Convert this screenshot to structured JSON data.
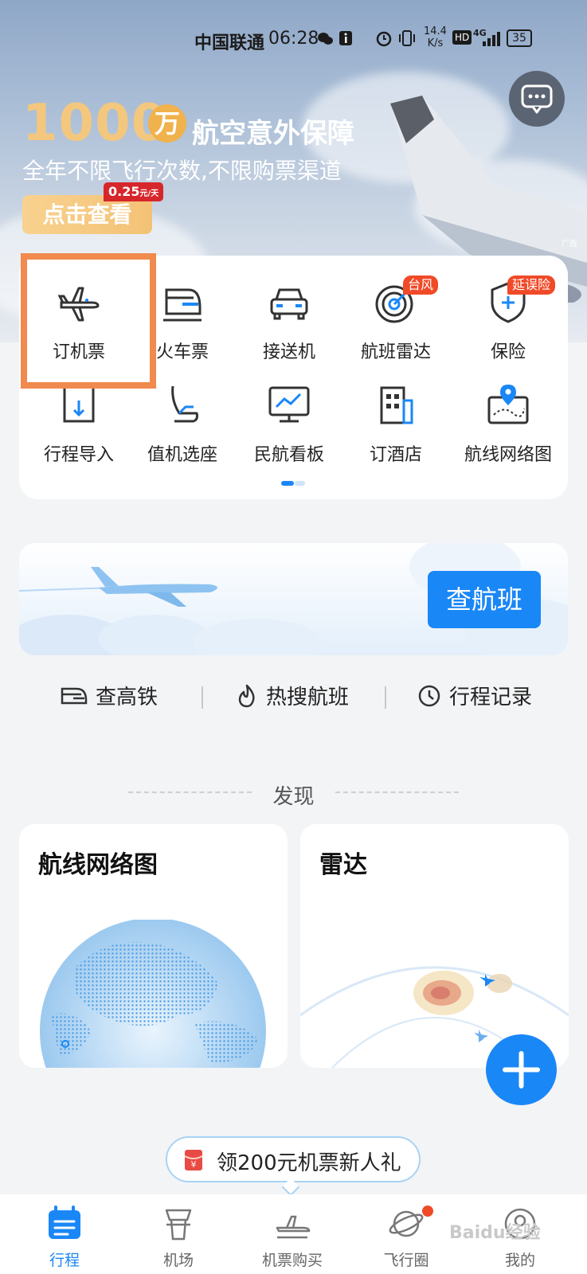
{
  "status_bar": {
    "carrier": "中国联通",
    "time": "06:28",
    "net_speed_value": "14.4",
    "net_speed_unit": "K/s",
    "hd": "HD",
    "network": "4G",
    "battery": "35"
  },
  "banner": {
    "big_number": "1000",
    "unit": "万",
    "title": "航空意外保障",
    "subtitle": "全年不限飞行次数,不限购票渠道",
    "button": "点击查看",
    "price": "0.25",
    "price_unit": "元/天",
    "ad_label": "广告"
  },
  "services": {
    "row1": [
      {
        "label": "订机票",
        "icon": "plane-icon"
      },
      {
        "label": "火车票",
        "icon": "train-icon"
      },
      {
        "label": "接送机",
        "icon": "car-icon"
      },
      {
        "label": "航班雷达",
        "icon": "radar-icon",
        "badge": "台风"
      },
      {
        "label": "保险",
        "icon": "shield-icon",
        "badge": "延误险"
      }
    ],
    "row2": [
      {
        "label": "行程导入",
        "icon": "import-icon"
      },
      {
        "label": "值机选座",
        "icon": "seat-icon"
      },
      {
        "label": "民航看板",
        "icon": "dashboard-icon"
      },
      {
        "label": "订酒店",
        "icon": "hotel-icon"
      },
      {
        "label": "航线网络图",
        "icon": "map-icon"
      }
    ]
  },
  "flight_query": {
    "button": "查航班"
  },
  "quick_links": [
    {
      "label": "查高铁",
      "icon": "train-icon"
    },
    {
      "label": "热搜航班",
      "icon": "flame-icon"
    },
    {
      "label": "行程记录",
      "icon": "clock-icon"
    }
  ],
  "discover": {
    "title": "发现",
    "cards": [
      {
        "title": "航线网络图"
      },
      {
        "title": "雷达"
      }
    ]
  },
  "new_user": {
    "label": "领200元机票新人礼",
    "icon_text": "¥"
  },
  "tabs": [
    {
      "label": "行程",
      "active": true
    },
    {
      "label": "机场",
      "active": false
    },
    {
      "label": "机票购买",
      "active": false
    },
    {
      "label": "飞行圈",
      "active": false
    },
    {
      "label": "我的",
      "active": false
    }
  ],
  "watermark": "Baidu经验",
  "colors": {
    "accent": "#1a87f7",
    "badge": "#f04a28",
    "highlight": "#f08a4e",
    "promo_gold": "#f3c77e"
  }
}
